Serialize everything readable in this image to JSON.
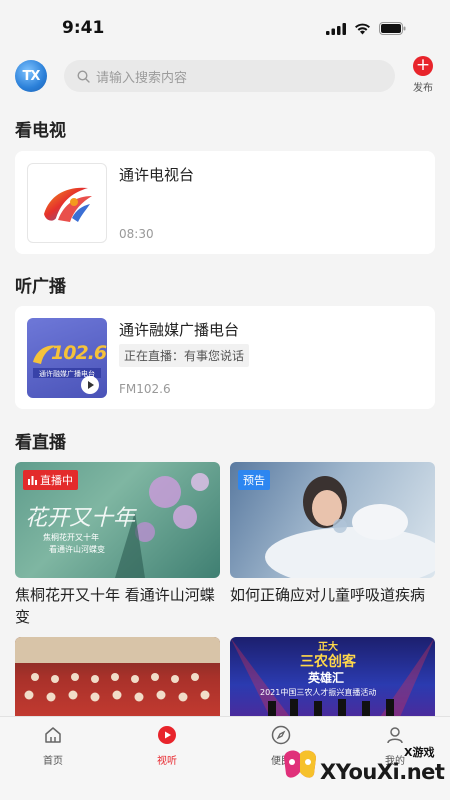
{
  "status": {
    "time": "9:41"
  },
  "header": {
    "avatar_text": "TX",
    "search_placeholder": "请输入搜索内容",
    "publish_label": "发布"
  },
  "tv": {
    "section_title": "看电视",
    "card": {
      "title": "通许电视台",
      "time": "08:30"
    }
  },
  "radio": {
    "section_title": "听广播",
    "card": {
      "title": "通许融媒广播电台",
      "live_text": "正在直播：有事您说话",
      "frequency": "FM102.6",
      "logo_number": "102.6",
      "logo_caption": "通许融媒广播电台"
    }
  },
  "live": {
    "section_title": "看直播",
    "tiles": [
      {
        "badge": "直播中",
        "title": "焦桐花开又十年 看通许山河蝶变",
        "art_text": "花开又十年",
        "art_caption_1": "焦桐花开又十年",
        "art_caption_2": "看通许山河蝶变"
      },
      {
        "badge": "预告",
        "title": "如何正确应对儿童呼吸道疾病"
      },
      {
        "badge": "",
        "title": ""
      },
      {
        "badge": "",
        "title": "",
        "art_title_1": "正大",
        "art_title_2": "三农创客",
        "art_title_3": "英雄汇",
        "art_caption": "2021中国三农人才振兴直播活动"
      }
    ]
  },
  "tabbar": {
    "items": [
      {
        "label": "首页",
        "icon": "home-icon"
      },
      {
        "label": "视听",
        "icon": "play-icon"
      },
      {
        "label": "便民",
        "icon": "compass-icon"
      },
      {
        "label": "我的",
        "icon": "user-icon"
      }
    ]
  },
  "watermark": {
    "tag": "X游戏",
    "site": "XYouXi.net"
  },
  "colors": {
    "accent": "#e8242b",
    "live_badge": "#e32b2b",
    "preview_badge": "#2d86f0",
    "background": "#f4f4f4"
  }
}
